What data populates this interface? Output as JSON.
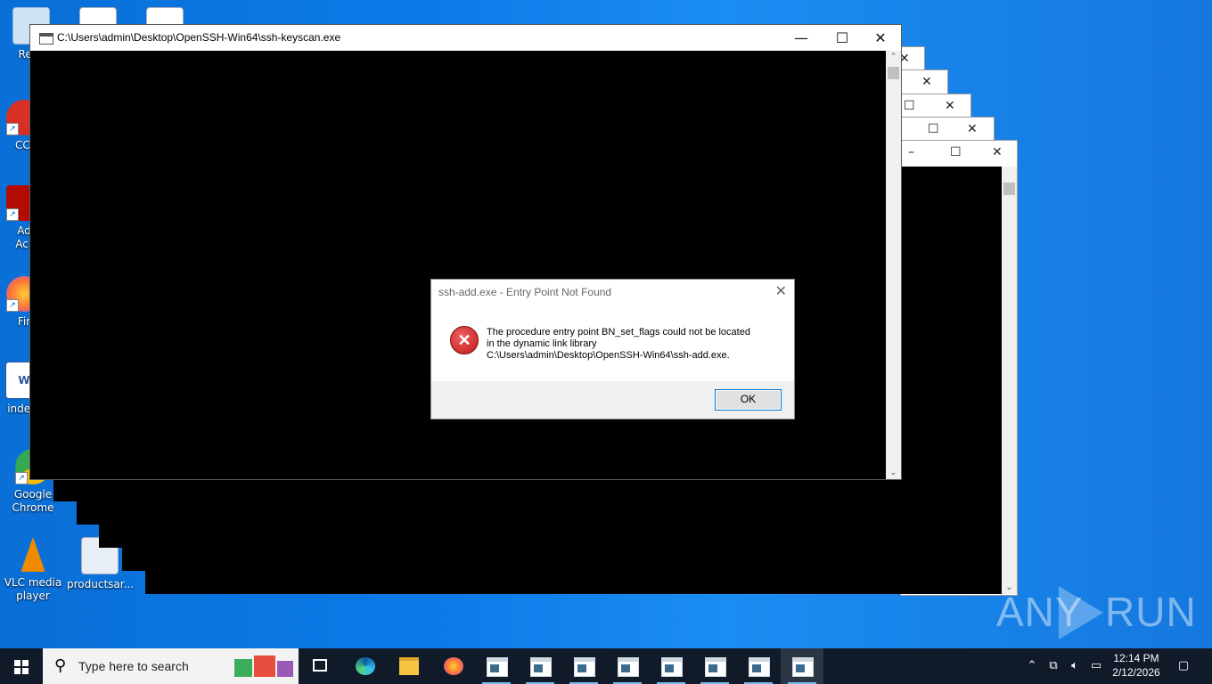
{
  "desktop": {
    "icons": [
      {
        "name": "recycle-bin",
        "label": "Recy",
        "color": "#cfe3f5"
      },
      {
        "name": "ccleaner",
        "label": "CCl",
        "color": "#d93025"
      },
      {
        "name": "adobe-acrobat",
        "label": "Ad\nAcr",
        "color": "#b30b00"
      },
      {
        "name": "firefox",
        "label": "Fir",
        "color": "#ff7139"
      },
      {
        "name": "word-doc",
        "label": "indext",
        "color": "#2b579a"
      },
      {
        "name": "google-chrome",
        "label": "Google\nChrome",
        "color": "#34a853"
      },
      {
        "name": "vlc",
        "label": "VLC media\nplayer",
        "color": "#f18a00"
      },
      {
        "name": "image-file",
        "label": "productsar...",
        "color": "#e8eef5"
      }
    ]
  },
  "console": {
    "title": "C:\\Users\\admin\\Desktop\\OpenSSH-Win64\\ssh-keyscan.exe",
    "controls": {
      "minimize": "—",
      "maximize": "☐",
      "close": "✕"
    }
  },
  "dialog": {
    "title": "ssh-add.exe - Entry Point Not Found",
    "close": "✕",
    "message_lines": [
      "The procedure entry point BN_set_flags could not be located",
      "in the dynamic link library",
      "C:\\Users\\admin\\Desktop\\OpenSSH-Win64\\ssh-add.exe."
    ],
    "ok_label": "OK"
  },
  "watermark": {
    "text_left": "ANY",
    "text_right": "RUN"
  },
  "taskbar": {
    "search_placeholder": "Type here to search",
    "clock_time": "12:14 PM",
    "clock_date": "2/12/2026",
    "colors": {
      "background": "#101a28",
      "accent": "#76b9ed"
    }
  }
}
